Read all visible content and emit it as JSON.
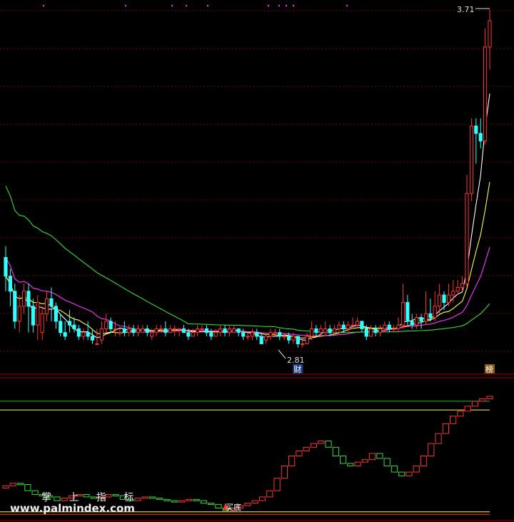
{
  "chart_data": [
    {
      "type": "candlestick",
      "panel": "main",
      "high_label": "3.71",
      "low_label": "2.81",
      "event_tags": [
        {
          "text": "财",
          "x_index": 64
        },
        {
          "text": "榜",
          "x_index": 110
        }
      ],
      "candles": [
        [
          3.05,
          3.0,
          3.08,
          2.96
        ],
        [
          3.0,
          2.96,
          3.02,
          2.92
        ],
        [
          2.96,
          2.88,
          2.98,
          2.86
        ],
        [
          2.88,
          2.92,
          2.95,
          2.85
        ],
        [
          2.92,
          2.96,
          2.98,
          2.9
        ],
        [
          2.96,
          2.92,
          2.98,
          2.85
        ],
        [
          2.92,
          2.87,
          2.94,
          2.85
        ],
        [
          2.87,
          2.93,
          2.95,
          2.83
        ],
        [
          2.85,
          2.9,
          2.92,
          2.83
        ],
        [
          2.9,
          2.94,
          2.96,
          2.88
        ],
        [
          2.94,
          2.92,
          2.97,
          2.88
        ],
        [
          2.92,
          2.88,
          2.93,
          2.86
        ],
        [
          2.88,
          2.85,
          2.9,
          2.84
        ],
        [
          2.85,
          2.84,
          2.88,
          2.83
        ],
        [
          2.88,
          2.87,
          2.91,
          2.85
        ],
        [
          2.87,
          2.86,
          2.89,
          2.85
        ],
        [
          2.86,
          2.84,
          2.87,
          2.83
        ],
        [
          2.84,
          2.85,
          2.86,
          2.83
        ],
        [
          2.85,
          2.84,
          2.88,
          2.83
        ],
        [
          2.84,
          2.83,
          2.86,
          2.82
        ],
        [
          2.82,
          2.82,
          2.86,
          2.82
        ],
        [
          2.83,
          2.86,
          2.88,
          2.82
        ],
        [
          2.86,
          2.88,
          2.9,
          2.85
        ],
        [
          2.88,
          2.86,
          2.89,
          2.85
        ],
        [
          2.86,
          2.86,
          2.88,
          2.84
        ],
        [
          2.85,
          2.85,
          2.86,
          2.84
        ],
        [
          2.86,
          2.85,
          2.88,
          2.84
        ],
        [
          2.85,
          2.86,
          2.87,
          2.84
        ],
        [
          2.86,
          2.85,
          2.87,
          2.84
        ],
        [
          2.85,
          2.86,
          2.87,
          2.84
        ],
        [
          2.85,
          2.86,
          2.87,
          2.85
        ],
        [
          2.86,
          2.85,
          2.87,
          2.84
        ],
        [
          2.84,
          2.85,
          2.86,
          2.83
        ],
        [
          2.85,
          2.86,
          2.87,
          2.84
        ],
        [
          2.86,
          2.86,
          2.87,
          2.85
        ],
        [
          2.86,
          2.85,
          2.88,
          2.84
        ],
        [
          2.85,
          2.86,
          2.87,
          2.85
        ],
        [
          2.86,
          2.86,
          2.87,
          2.84
        ],
        [
          2.86,
          2.86,
          2.86,
          2.84
        ],
        [
          2.86,
          2.85,
          2.87,
          2.85
        ],
        [
          2.85,
          2.84,
          2.86,
          2.83
        ],
        [
          2.84,
          2.85,
          2.86,
          2.84
        ],
        [
          2.85,
          2.86,
          2.87,
          2.84
        ],
        [
          2.86,
          2.86,
          2.87,
          2.85
        ],
        [
          2.86,
          2.85,
          2.87,
          2.84
        ],
        [
          2.85,
          2.84,
          2.86,
          2.83
        ],
        [
          2.84,
          2.85,
          2.86,
          2.84
        ],
        [
          2.85,
          2.86,
          2.87,
          2.84
        ],
        [
          2.86,
          2.85,
          2.87,
          2.84
        ],
        [
          2.85,
          2.86,
          2.87,
          2.84
        ],
        [
          2.85,
          2.86,
          2.87,
          2.85
        ],
        [
          2.86,
          2.85,
          2.86,
          2.84
        ],
        [
          2.85,
          2.84,
          2.86,
          2.83
        ],
        [
          2.84,
          2.84,
          2.85,
          2.83
        ],
        [
          2.84,
          2.85,
          2.86,
          2.83
        ],
        [
          2.85,
          2.84,
          2.86,
          2.83
        ],
        [
          2.84,
          2.82,
          2.85,
          2.82
        ],
        [
          2.83,
          2.84,
          2.85,
          2.82
        ],
        [
          2.84,
          2.85,
          2.86,
          2.83
        ],
        [
          2.85,
          2.85,
          2.86,
          2.84
        ],
        [
          2.85,
          2.84,
          2.86,
          2.83
        ],
        [
          2.84,
          2.84,
          2.85,
          2.83
        ],
        [
          2.84,
          2.83,
          2.85,
          2.82
        ],
        [
          2.83,
          2.84,
          2.85,
          2.82
        ],
        [
          2.84,
          2.82,
          2.84,
          2.81
        ],
        [
          2.82,
          2.82,
          2.83,
          2.81
        ],
        [
          2.82,
          2.84,
          2.85,
          2.82
        ],
        [
          2.84,
          2.86,
          2.88,
          2.83
        ],
        [
          2.86,
          2.85,
          2.87,
          2.84
        ],
        [
          2.85,
          2.86,
          2.87,
          2.84
        ],
        [
          2.85,
          2.86,
          2.88,
          2.84
        ],
        [
          2.86,
          2.85,
          2.87,
          2.84
        ],
        [
          2.85,
          2.86,
          2.87,
          2.85
        ],
        [
          2.86,
          2.87,
          2.88,
          2.85
        ],
        [
          2.87,
          2.86,
          2.88,
          2.85
        ],
        [
          2.86,
          2.87,
          2.88,
          2.85
        ],
        [
          2.87,
          2.87,
          2.89,
          2.86
        ],
        [
          2.87,
          2.88,
          2.89,
          2.86
        ],
        [
          2.88,
          2.86,
          2.88,
          2.85
        ],
        [
          2.86,
          2.84,
          2.87,
          2.83
        ],
        [
          2.84,
          2.86,
          2.87,
          2.84
        ],
        [
          2.86,
          2.85,
          2.87,
          2.84
        ],
        [
          2.85,
          2.86,
          2.87,
          2.84
        ],
        [
          2.86,
          2.87,
          2.88,
          2.85
        ],
        [
          2.87,
          2.86,
          2.88,
          2.85
        ],
        [
          2.86,
          2.86,
          2.87,
          2.85
        ],
        [
          2.86,
          2.87,
          2.89,
          2.85
        ],
        [
          2.87,
          2.93,
          2.98,
          2.86
        ],
        [
          2.93,
          2.88,
          2.95,
          2.87
        ],
        [
          2.88,
          2.87,
          2.9,
          2.86
        ],
        [
          2.87,
          2.89,
          2.9,
          2.86
        ],
        [
          2.89,
          2.88,
          2.9,
          2.86
        ],
        [
          2.88,
          2.9,
          2.96,
          2.87
        ],
        [
          2.9,
          2.89,
          2.94,
          2.88
        ],
        [
          2.89,
          2.92,
          2.96,
          2.88
        ],
        [
          2.92,
          2.95,
          2.98,
          2.9
        ],
        [
          2.95,
          2.93,
          2.96,
          2.91
        ],
        [
          2.93,
          2.95,
          2.98,
          2.92
        ],
        [
          2.95,
          2.96,
          2.99,
          2.93
        ],
        [
          2.96,
          2.97,
          2.99,
          2.95
        ],
        [
          2.97,
          2.98,
          3.0,
          2.96
        ],
        [
          2.98,
          3.22,
          3.27,
          2.97
        ],
        [
          3.22,
          3.4,
          3.42,
          3.2
        ],
        [
          3.4,
          3.38,
          3.42,
          3.3
        ],
        [
          3.38,
          3.36,
          3.42,
          3.34
        ],
        [
          3.36,
          3.61,
          3.66,
          3.35
        ],
        [
          3.61,
          3.68,
          3.71,
          3.55
        ]
      ],
      "ma_series": [
        {
          "color": "#ffffff"
        },
        {
          "color": "#ffff33"
        },
        {
          "color": "#ff33ff"
        },
        {
          "color": "#33dd33"
        }
      ],
      "up_color": "#ff3333",
      "down_color": "#33ffff"
    },
    {
      "type": "candlestick",
      "panel": "indicator",
      "title": "掌 上 指 标",
      "signal_text": "买底",
      "watermark": "www.palmindex.com",
      "reference_lines": [
        {
          "value": 92,
          "color": "#00cc00"
        },
        {
          "value": 85,
          "color": "#ffff33"
        },
        {
          "value": 3,
          "color": "#ffff33"
        },
        {
          "value": 1,
          "color": "#ff3333"
        }
      ],
      "values": [
        [
          22,
          24
        ],
        [
          24,
          26
        ],
        [
          26,
          25
        ],
        [
          25,
          20
        ],
        [
          20,
          17
        ],
        [
          17,
          16
        ],
        [
          16,
          15
        ],
        [
          15,
          12
        ],
        [
          12,
          14
        ],
        [
          14,
          16
        ],
        [
          16,
          17
        ],
        [
          17,
          15
        ],
        [
          15,
          14
        ],
        [
          14,
          15
        ],
        [
          15,
          17
        ],
        [
          17,
          16
        ],
        [
          16,
          13
        ],
        [
          13,
          12
        ],
        [
          12,
          14
        ],
        [
          14,
          15
        ],
        [
          15,
          14
        ],
        [
          14,
          13
        ],
        [
          13,
          12
        ],
        [
          12,
          11
        ],
        [
          11,
          12
        ],
        [
          12,
          13
        ],
        [
          13,
          12
        ],
        [
          12,
          10
        ],
        [
          10,
          9
        ],
        [
          9,
          6
        ],
        [
          6,
          4
        ],
        [
          4,
          6
        ],
        [
          6,
          8
        ],
        [
          8,
          10
        ],
        [
          10,
          12
        ],
        [
          12,
          15
        ],
        [
          15,
          20
        ],
        [
          20,
          30
        ],
        [
          30,
          40
        ],
        [
          40,
          48
        ],
        [
          48,
          52
        ],
        [
          52,
          55
        ],
        [
          55,
          58
        ],
        [
          58,
          60
        ],
        [
          60,
          55
        ],
        [
          55,
          48
        ],
        [
          48,
          42
        ],
        [
          42,
          40
        ],
        [
          40,
          43
        ],
        [
          43,
          45
        ],
        [
          45,
          50
        ],
        [
          50,
          46
        ],
        [
          46,
          40
        ],
        [
          40,
          35
        ],
        [
          35,
          32
        ],
        [
          32,
          35
        ],
        [
          35,
          40
        ],
        [
          40,
          48
        ],
        [
          48,
          58
        ],
        [
          58,
          66
        ],
        [
          66,
          74
        ],
        [
          74,
          80
        ],
        [
          80,
          84
        ],
        [
          84,
          88
        ],
        [
          88,
          92
        ],
        [
          92,
          94
        ],
        [
          94,
          96
        ]
      ]
    }
  ]
}
